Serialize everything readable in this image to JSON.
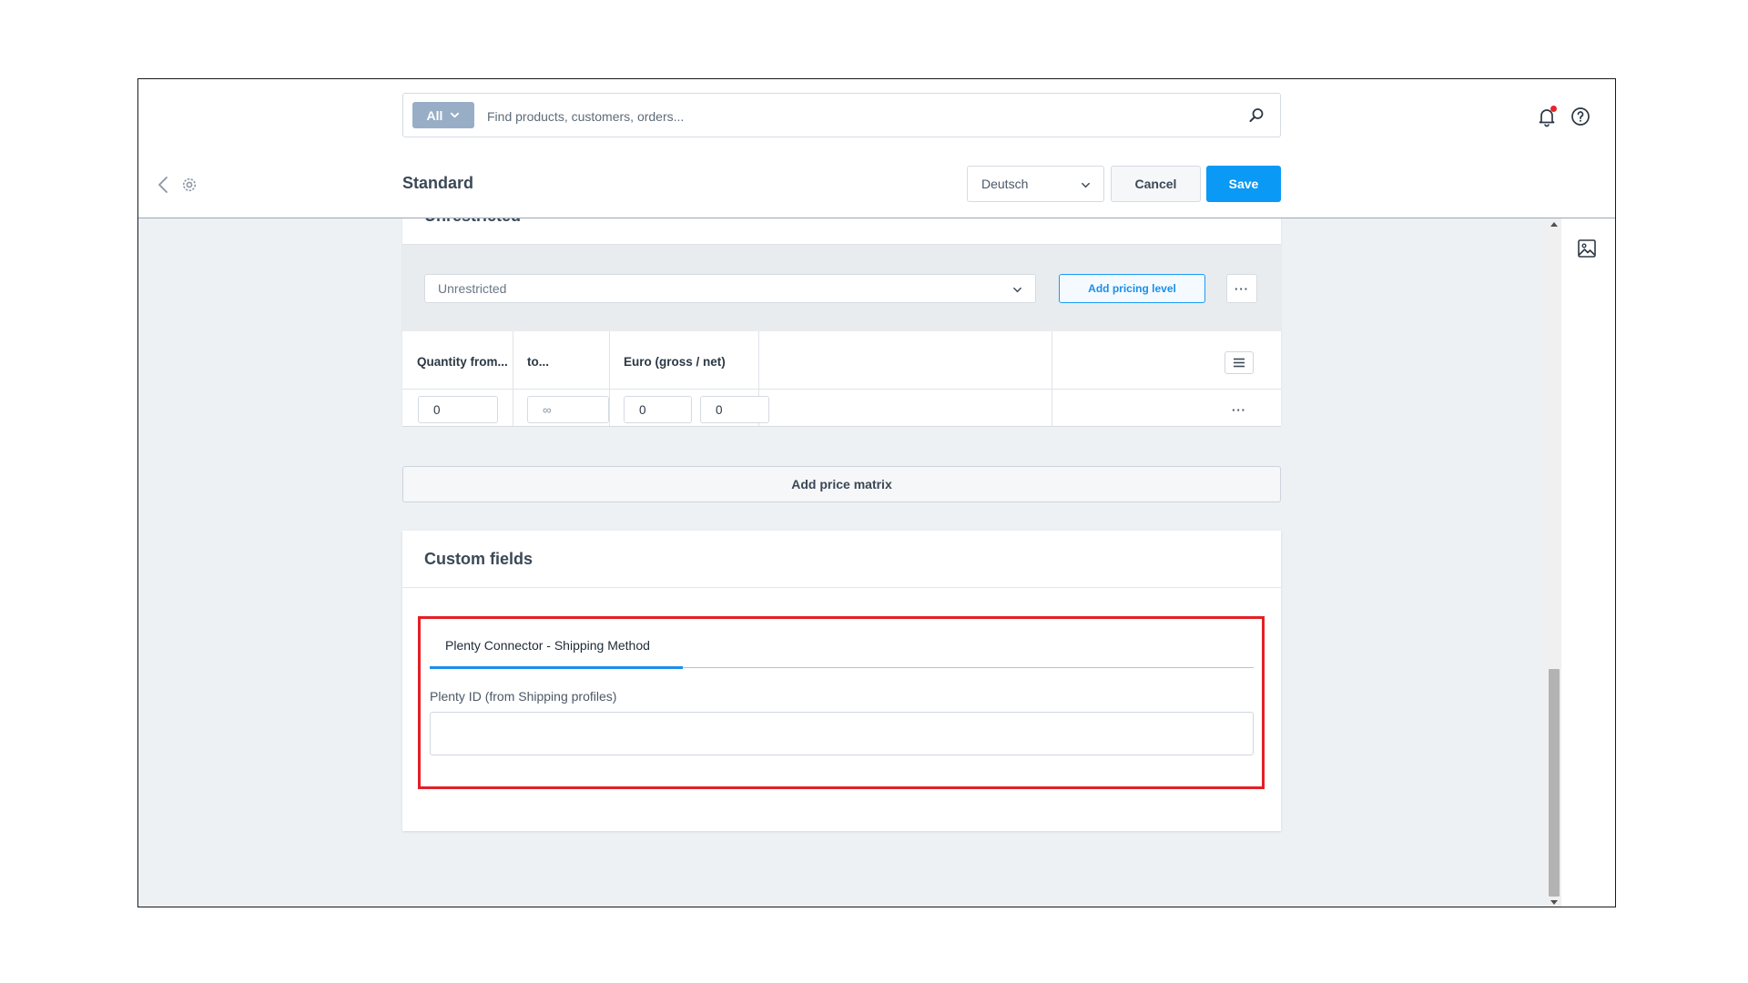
{
  "search": {
    "scope_label": "All",
    "placeholder": "Find products, customers, orders...",
    "value": ""
  },
  "header": {
    "title": "Standard",
    "language": "Deutsch",
    "cancel_label": "Cancel",
    "save_label": "Save"
  },
  "pricing": {
    "section_heading": "Unrestricted",
    "restriction_placeholder": "Unrestricted",
    "add_level_label": "Add pricing level",
    "more_label": "···",
    "columns": [
      "Quantity from...",
      "to...",
      "Euro (gross / net)"
    ],
    "row": {
      "quantity_from": "0",
      "quantity_to_placeholder": "∞",
      "price_gross": "0",
      "price_net": "0",
      "more_label": "···"
    },
    "add_matrix_label": "Add price matrix"
  },
  "custom_fields": {
    "title": "Custom fields",
    "tab_label": "Plenty Connector - Shipping Method",
    "field_label": "Plenty ID (from Shipping profiles)",
    "field_value": ""
  },
  "icons": {
    "search": "search-icon",
    "bell": "bell-icon",
    "help": "help-circle-icon",
    "back": "chevron-left-icon",
    "settings": "gear-icon",
    "chevron_down": "chevron-down-icon",
    "menu": "hamburger-menu-icon",
    "image": "image-icon"
  },
  "colors": {
    "accent": "#0a99f5",
    "highlight_border": "#e41e26",
    "notification_dot": "#e5262d",
    "chip_background": "#98aec6"
  }
}
